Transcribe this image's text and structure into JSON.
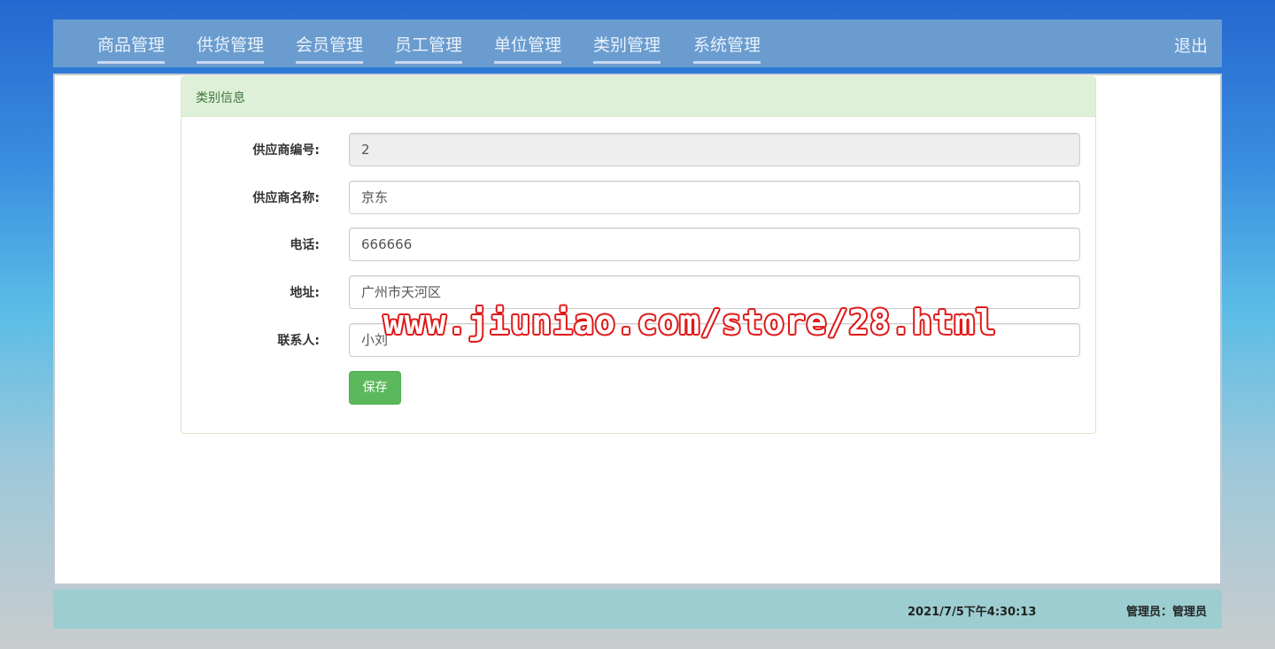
{
  "nav": {
    "items": [
      {
        "label": "商品管理"
      },
      {
        "label": "供货管理"
      },
      {
        "label": "会员管理"
      },
      {
        "label": "员工管理"
      },
      {
        "label": "单位管理"
      },
      {
        "label": "类别管理"
      },
      {
        "label": "系统管理"
      }
    ],
    "logout": "退出"
  },
  "panel": {
    "title": "类别信息",
    "fields": [
      {
        "label": "供应商编号:",
        "value": "2",
        "disabled": true
      },
      {
        "label": "供应商名称:",
        "value": "京东"
      },
      {
        "label": "电话:",
        "value": "666666"
      },
      {
        "label": "地址:",
        "value": "广州市天河区"
      },
      {
        "label": "联系人:",
        "value": "小刘"
      }
    ],
    "save_label": "保存"
  },
  "watermark": "www.jiuniao.com/store/28.html",
  "footer": {
    "datetime": "2021/7/5下午4:30:13",
    "user": "管理员：管理员"
  },
  "colors": {
    "nav_bg": "#6a9ccf",
    "panel_heading_bg": "#dff0d8",
    "panel_heading_text": "#3c763d",
    "save_button": "#5cb85c",
    "footer_bg": "#9ccdd0",
    "watermark_outline": "#e01818"
  }
}
